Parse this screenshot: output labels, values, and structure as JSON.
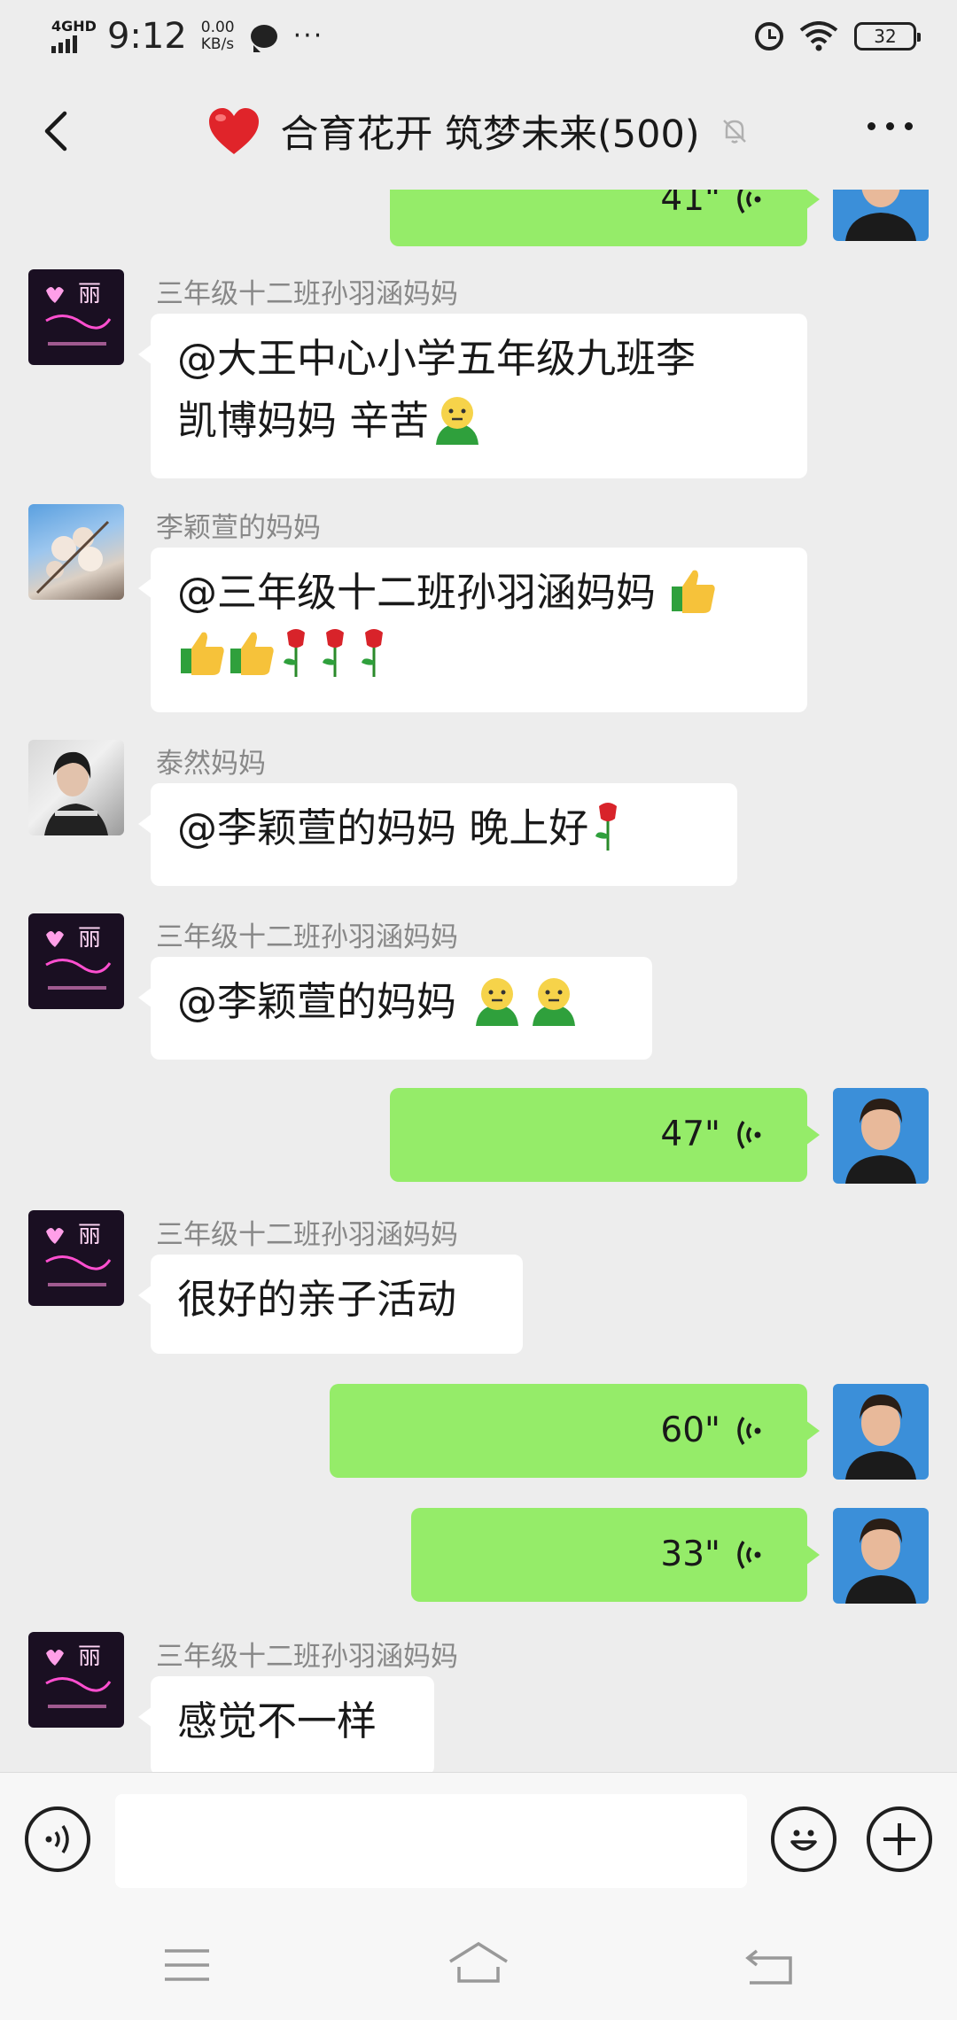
{
  "status_bar": {
    "network": "4GHD",
    "time": "9:12",
    "speed_value": "0.00",
    "speed_unit": "KB/s",
    "battery": "32"
  },
  "header": {
    "title": "合育花开 筑梦未来(500)"
  },
  "messages": [
    {
      "type": "voice",
      "direction": "out",
      "duration": "41\""
    },
    {
      "type": "text",
      "direction": "in",
      "sender": "三年级十二班孙羽涵妈妈",
      "line1": "@大王中心小学五年级九班李",
      "line2": "凯博妈妈  辛苦"
    },
    {
      "type": "text",
      "direction": "in",
      "sender": "李颖萱的妈妈",
      "line1": "@三年级十二班孙羽涵妈妈 "
    },
    {
      "type": "text",
      "direction": "in",
      "sender": "泰然妈妈",
      "line1": "@李颖萱的妈妈  晚上好"
    },
    {
      "type": "text",
      "direction": "in",
      "sender": "三年级十二班孙羽涵妈妈",
      "line1": "@李颖萱的妈妈  "
    },
    {
      "type": "voice",
      "direction": "out",
      "duration": "47\""
    },
    {
      "type": "text",
      "direction": "in",
      "sender": "三年级十二班孙羽涵妈妈",
      "line1": "很好的亲子活动"
    },
    {
      "type": "voice",
      "direction": "out",
      "duration": "60\""
    },
    {
      "type": "voice",
      "direction": "out",
      "duration": "33\""
    },
    {
      "type": "text",
      "direction": "in",
      "sender": "三年级十二班孙羽涵妈妈",
      "line1": "感觉不一样"
    }
  ],
  "input": {
    "value": ""
  },
  "colors": {
    "out_bubble": "#95ec69",
    "in_bubble": "#ffffff",
    "background": "#ededed"
  },
  "icons": [
    "back-arrow-icon",
    "heart-icon",
    "mute-bell-icon",
    "more-icon",
    "voice-input-icon",
    "emoji-icon",
    "plus-icon",
    "nav-menu-icon",
    "nav-home-icon",
    "nav-back-icon"
  ]
}
